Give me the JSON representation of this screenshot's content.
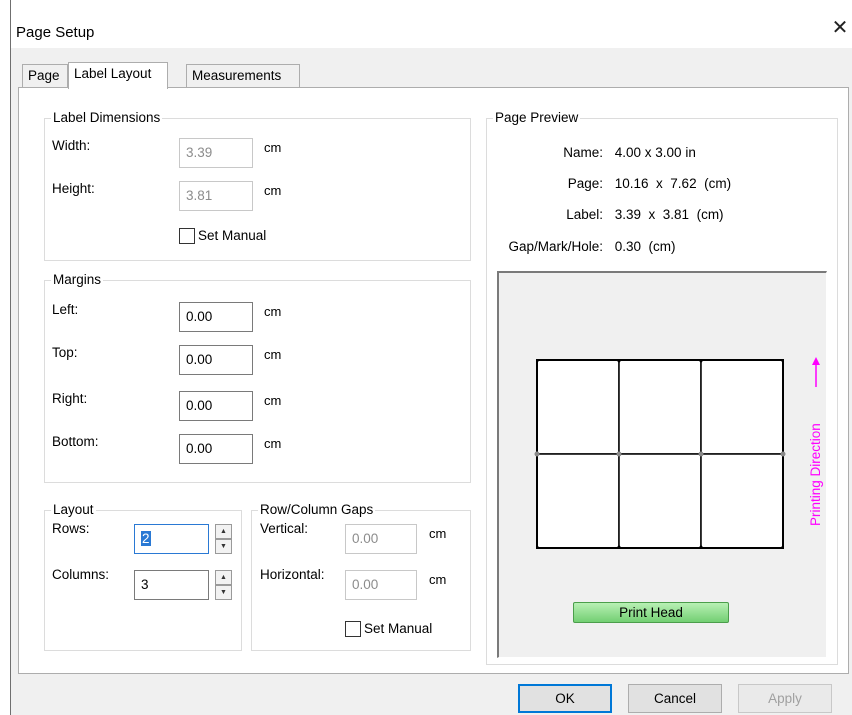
{
  "window": {
    "title": "Page Setup",
    "close_glyph": "✕"
  },
  "tabs": [
    {
      "label": "Page"
    },
    {
      "label": "Label Layout"
    },
    {
      "label": "Measurements"
    }
  ],
  "label_dimensions": {
    "title": "Label Dimensions",
    "width_label": "Width:",
    "width_value": "3.39",
    "width_unit": "cm",
    "height_label": "Height:",
    "height_value": "3.81",
    "height_unit": "cm",
    "set_manual_label": "Set Manual",
    "set_manual_checked": false
  },
  "margins": {
    "title": "Margins",
    "left_label": "Left:",
    "left_value": "0.00",
    "top_label": "Top:",
    "top_value": "0.00",
    "right_label": "Right:",
    "right_value": "0.00",
    "bottom_label": "Bottom:",
    "bottom_value": "0.00",
    "unit": "cm"
  },
  "layout": {
    "title": "Layout",
    "rows_label": "Rows:",
    "rows_value": "2",
    "columns_label": "Columns:",
    "columns_value": "3"
  },
  "gaps": {
    "title": "Row/Column Gaps",
    "vertical_label": "Vertical:",
    "vertical_value": "0.00",
    "horizontal_label": "Horizontal:",
    "horizontal_value": "0.00",
    "unit": "cm",
    "set_manual_label": "Set Manual",
    "set_manual_checked": false
  },
  "preview": {
    "title": "Page Preview",
    "name_key": "Name:",
    "name_value": "4.00 x 3.00 in",
    "page_key": "Page:",
    "page_value": "10.16  x  7.62  (cm)",
    "label_key": "Label:",
    "label_value": "3.39  x  3.81  (cm)",
    "gap_key": "Gap/Mark/Hole:",
    "gap_value": "0.30  (cm)",
    "print_head_label": "Print Head",
    "direction_label": "Printing Direction",
    "grid_rows": 2,
    "grid_columns": 3,
    "direction_color": "#ff00ff",
    "print_head_color": "#7fd87f"
  },
  "buttons": {
    "ok": "OK",
    "cancel": "Cancel",
    "apply": "Apply"
  },
  "colors": {
    "focus_blue": "#2a79d4",
    "default_button_border": "#0078d7"
  }
}
